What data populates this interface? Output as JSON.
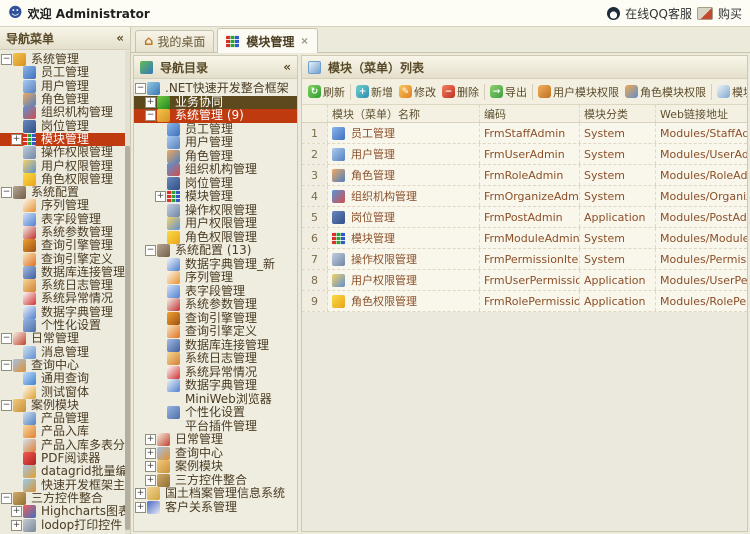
{
  "topbar": {
    "welcome": "欢迎 Administrator",
    "online_service": "在线QQ客服",
    "buy": "购买"
  },
  "tabs": [
    {
      "label": "我的桌面",
      "icon": "home",
      "active": false,
      "closable": false
    },
    {
      "label": "模块管理",
      "icon": "module",
      "active": true,
      "closable": true,
      "close_glyph": "×"
    }
  ],
  "left_panel": {
    "title": "导航菜单",
    "collapse_glyph": "«",
    "items": [
      {
        "l": "系统管理",
        "i": "sysfolder",
        "v": 0,
        "e": "-",
        "s": ""
      },
      {
        "l": "员工管理",
        "i": "staff",
        "v": 1,
        "e": "",
        "s": ""
      },
      {
        "l": "用户管理",
        "i": "user",
        "v": 1,
        "e": "",
        "s": ""
      },
      {
        "l": "角色管理",
        "i": "role",
        "v": 1,
        "e": "",
        "s": ""
      },
      {
        "l": "组织机构管理",
        "i": "org",
        "v": 1,
        "e": "",
        "s": ""
      },
      {
        "l": "岗位管理",
        "i": "post",
        "v": 1,
        "e": "",
        "s": ""
      },
      {
        "l": "模块管理",
        "i": "module",
        "v": 1,
        "e": "+",
        "s": "selo"
      },
      {
        "l": "操作权限管理",
        "i": "perm",
        "v": 1,
        "e": "",
        "s": ""
      },
      {
        "l": "用户权限管理",
        "i": "userperm",
        "v": 1,
        "e": "",
        "s": ""
      },
      {
        "l": "角色权限管理",
        "i": "roleperm",
        "v": 1,
        "e": "",
        "s": ""
      },
      {
        "l": "系统配置",
        "i": "config",
        "v": 0,
        "e": "-",
        "s": ""
      },
      {
        "l": "序列管理",
        "i": "seq",
        "v": 1,
        "e": "",
        "s": ""
      },
      {
        "l": "表字段管理",
        "i": "field",
        "v": 1,
        "e": "",
        "s": ""
      },
      {
        "l": "系统参数管理",
        "i": "param",
        "v": 1,
        "e": "",
        "s": ""
      },
      {
        "l": "查询引擎管理",
        "i": "engine",
        "v": 1,
        "e": "",
        "s": ""
      },
      {
        "l": "查询引擎定义",
        "i": "enginedef",
        "v": 1,
        "e": "",
        "s": ""
      },
      {
        "l": "数据库连接管理",
        "i": "db",
        "v": 1,
        "e": "",
        "s": ""
      },
      {
        "l": "系统日志管理",
        "i": "log",
        "v": 1,
        "e": "",
        "s": ""
      },
      {
        "l": "系统异常情况",
        "i": "error",
        "v": 1,
        "e": "",
        "s": ""
      },
      {
        "l": "数据字典管理",
        "i": "dict",
        "v": 1,
        "e": "",
        "s": ""
      },
      {
        "l": "个性化设置",
        "i": "personal",
        "v": 1,
        "e": "",
        "s": ""
      },
      {
        "l": "日常管理",
        "i": "daily",
        "v": 0,
        "e": "-",
        "s": ""
      },
      {
        "l": "消息管理",
        "i": "msg",
        "v": 1,
        "e": "",
        "s": ""
      },
      {
        "l": "查询中心",
        "i": "qcenter",
        "v": 0,
        "e": "-",
        "s": ""
      },
      {
        "l": "通用查询",
        "i": "query",
        "v": 1,
        "e": "",
        "s": ""
      },
      {
        "l": "测试窗体",
        "i": "testform",
        "v": 1,
        "e": "",
        "s": ""
      },
      {
        "l": "案例模块",
        "i": "casebox",
        "v": 0,
        "e": "-",
        "s": ""
      },
      {
        "l": "产品管理",
        "i": "product",
        "v": 1,
        "e": "",
        "s": ""
      },
      {
        "l": "产品入库",
        "i": "productin",
        "v": 1,
        "e": "",
        "s": ""
      },
      {
        "l": "产品入库多表分页",
        "i": "productpage",
        "v": 1,
        "e": "",
        "s": ""
      },
      {
        "l": "PDF阅读器",
        "i": "pdf",
        "v": 1,
        "e": "",
        "s": ""
      },
      {
        "l": "datagrid批量编辑",
        "i": "datagrid",
        "v": 1,
        "e": "",
        "s": ""
      },
      {
        "l": "快速开发框架主页",
        "i": "homepage",
        "v": 1,
        "e": "",
        "s": ""
      },
      {
        "l": "三方控件整合",
        "i": "thirdparty",
        "v": 0,
        "e": "-",
        "s": ""
      },
      {
        "l": "Highcharts图表",
        "i": "highcharts",
        "v": 1,
        "e": "+",
        "s": ""
      },
      {
        "l": "lodop打印控件",
        "i": "lodop",
        "v": 1,
        "e": "+",
        "s": ""
      }
    ]
  },
  "nav_panel": {
    "title": "导航目录",
    "collapse_glyph": "«",
    "items": [
      {
        "l": ".NET快速开发整合框架",
        "i": "netroot",
        "v": 0,
        "e": "-",
        "s": ""
      },
      {
        "l": "业务协同",
        "i": "biz",
        "v": 1,
        "e": "+",
        "s": "seld"
      },
      {
        "l": "系统管理 (9)",
        "i": "sysfolder",
        "v": 1,
        "e": "-",
        "s": "selo"
      },
      {
        "l": "员工管理",
        "i": "staff",
        "v": 2,
        "e": "",
        "s": ""
      },
      {
        "l": "用户管理",
        "i": "user",
        "v": 2,
        "e": "",
        "s": ""
      },
      {
        "l": "角色管理",
        "i": "role",
        "v": 2,
        "e": "",
        "s": ""
      },
      {
        "l": "组织机构管理",
        "i": "org",
        "v": 2,
        "e": "",
        "s": ""
      },
      {
        "l": "岗位管理",
        "i": "post",
        "v": 2,
        "e": "",
        "s": ""
      },
      {
        "l": "模块管理",
        "i": "module",
        "v": 2,
        "e": "+",
        "s": ""
      },
      {
        "l": "操作权限管理",
        "i": "perm",
        "v": 2,
        "e": "",
        "s": ""
      },
      {
        "l": "用户权限管理",
        "i": "userperm",
        "v": 2,
        "e": "",
        "s": ""
      },
      {
        "l": "角色权限管理",
        "i": "roleperm",
        "v": 2,
        "e": "",
        "s": ""
      },
      {
        "l": "系统配置 (13)",
        "i": "config",
        "v": 1,
        "e": "-",
        "s": ""
      },
      {
        "l": "数据字典管理_新",
        "i": "dict",
        "v": 2,
        "e": "",
        "s": ""
      },
      {
        "l": "序列管理",
        "i": "seq",
        "v": 2,
        "e": "",
        "s": ""
      },
      {
        "l": "表字段管理",
        "i": "field",
        "v": 2,
        "e": "",
        "s": ""
      },
      {
        "l": "系统参数管理",
        "i": "param",
        "v": 2,
        "e": "",
        "s": ""
      },
      {
        "l": "查询引擎管理",
        "i": "engine",
        "v": 2,
        "e": "",
        "s": ""
      },
      {
        "l": "查询引擎定义",
        "i": "enginedef",
        "v": 2,
        "e": "",
        "s": ""
      },
      {
        "l": "数据库连接管理",
        "i": "db",
        "v": 2,
        "e": "",
        "s": ""
      },
      {
        "l": "系统日志管理",
        "i": "log",
        "v": 2,
        "e": "",
        "s": ""
      },
      {
        "l": "系统异常情况",
        "i": "error",
        "v": 2,
        "e": "",
        "s": ""
      },
      {
        "l": "数据字典管理",
        "i": "dict",
        "v": 2,
        "e": "",
        "s": ""
      },
      {
        "l": "MiniWeb浏览器",
        "i": "miniweb",
        "v": 2,
        "e": "",
        "s": ""
      },
      {
        "l": "个性化设置",
        "i": "personal",
        "v": 2,
        "e": "",
        "s": ""
      },
      {
        "l": "平台插件管理",
        "i": "plugin",
        "v": 2,
        "e": "",
        "s": ""
      },
      {
        "l": "日常管理",
        "i": "daily",
        "v": 1,
        "e": "+",
        "s": ""
      },
      {
        "l": "查询中心",
        "i": "qcenter",
        "v": 1,
        "e": "+",
        "s": ""
      },
      {
        "l": "案例模块",
        "i": "casebox",
        "v": 1,
        "e": "+",
        "s": ""
      },
      {
        "l": "三方控件整合",
        "i": "thirdparty",
        "v": 1,
        "e": "+",
        "s": ""
      },
      {
        "l": "国土档案管理信息系统",
        "i": "landfolder",
        "v": 0,
        "e": "+",
        "s": ""
      },
      {
        "l": "客户关系管理",
        "i": "crm",
        "v": 0,
        "e": "+",
        "s": ""
      }
    ]
  },
  "list_panel": {
    "title": "模块（菜单）列表",
    "toolbar": [
      {
        "type": "button",
        "label": "刷新",
        "icon": "refresh"
      },
      {
        "type": "separator"
      },
      {
        "type": "button",
        "label": "新增",
        "icon": "add"
      },
      {
        "type": "button",
        "label": "修改",
        "icon": "edit"
      },
      {
        "type": "button",
        "label": "删除",
        "icon": "delete"
      },
      {
        "type": "separator"
      },
      {
        "type": "button",
        "label": "导出",
        "icon": "export"
      },
      {
        "type": "separator"
      },
      {
        "type": "button",
        "label": "用户模块权限",
        "icon": "usermodperm"
      },
      {
        "type": "button",
        "label": "角色模块权限",
        "icon": "rolemodperm"
      },
      {
        "type": "separator"
      },
      {
        "type": "button",
        "label": "模块配置",
        "icon": "modconfig"
      }
    ],
    "grid": {
      "columns": [
        "",
        "模块（菜单）名称",
        "编码",
        "模块分类",
        "Web链接地址"
      ],
      "rows": [
        {
          "num": "1",
          "icon": "staff",
          "name": "员工管理",
          "code": "FrmStaffAdmin",
          "category": "System",
          "web": "Modules/StaffAdmin"
        },
        {
          "num": "2",
          "icon": "user",
          "name": "用户管理",
          "code": "FrmUserAdmin",
          "category": "System",
          "web": "Modules/UserAdmin"
        },
        {
          "num": "3",
          "icon": "role",
          "name": "角色管理",
          "code": "FrmRoleAdmin",
          "category": "System",
          "web": "Modules/RoleAdmin"
        },
        {
          "num": "4",
          "icon": "org",
          "name": "组织机构管理",
          "code": "FrmOrganizeAdmin",
          "category": "System",
          "web": "Modules/OrganizeA"
        },
        {
          "num": "5",
          "icon": "post",
          "name": "岗位管理",
          "code": "FrmPostAdmin",
          "category": "Application",
          "web": "Modules/PostAdmin"
        },
        {
          "num": "6",
          "icon": "module",
          "name": "模块管理",
          "code": "FrmModuleAdmin",
          "category": "System",
          "web": "Modules/ModuleAd"
        },
        {
          "num": "7",
          "icon": "perm",
          "name": "操作权限管理",
          "code": "FrmPermissionItemA",
          "category": "System",
          "web": "Modules/Permission"
        },
        {
          "num": "8",
          "icon": "userperm",
          "name": "用户权限管理",
          "code": "FrmUserPermissionA",
          "category": "Application",
          "web": "Modules/UserPermi"
        },
        {
          "num": "9",
          "icon": "roleperm",
          "name": "角色权限管理",
          "code": "FrmRolePermissionA",
          "category": "Application",
          "web": "Modules/RolePermi"
        }
      ]
    }
  },
  "colors": {
    "selected_node_bg": "#c03a10",
    "dark_node_bg": "#5c4a1e",
    "panel_header_text": "#584a28",
    "grid_text": "#8a4f28",
    "toolbar_bg": "#f3f0e2"
  },
  "icon_colors": {
    "sysfolder": [
      "#f2c44e",
      "#d89020"
    ],
    "staff": [
      "#8ab6e8",
      "#3f6fbf"
    ],
    "user": [
      "#a9cbee",
      "#5580c0"
    ],
    "role": [
      "#f0a860",
      "#4f7fc0"
    ],
    "org": [
      "#5a94d4",
      "#cf4f4f"
    ],
    "post": [
      "#6a88bc",
      "#2f4f88"
    ],
    "module": [
      "#d83028",
      "#3158c8"
    ],
    "perm": [
      "#c3cedd",
      "#6f85a8"
    ],
    "userperm": [
      "#f2d367",
      "#5f8fd0"
    ],
    "roleperm": [
      "#fbda45",
      "#e8a41c"
    ],
    "config": [
      "#b6a695",
      "#74604a"
    ],
    "seq": [
      "#fbf8ee",
      "#e89030"
    ],
    "field": [
      "#d3e2f7",
      "#4f7fd0"
    ],
    "param": [
      "#f3f2ea",
      "#c23030"
    ],
    "engine": [
      "#f2a132",
      "#9e5010"
    ],
    "enginedef": [
      "#f8e8c0",
      "#e07020"
    ],
    "db": [
      "#a4bce2",
      "#3f5fa0"
    ],
    "log": [
      "#f8d898",
      "#d08030"
    ],
    "error": [
      "#fbfbf8",
      "#d03030"
    ],
    "dict": [
      "#f0f4f8",
      "#4f7fd0"
    ],
    "personal": [
      "#94b8e2",
      "#4f6fa8"
    ],
    "daily": [
      "#f8f0e0",
      "#c04030"
    ],
    "msg": [
      "#d2e2f2",
      "#5f8fd0"
    ],
    "qcenter": [
      "#a2c2e8",
      "#e09030"
    ],
    "query": [
      "#c2e1f8",
      "#3f7fd0"
    ],
    "testform": [
      "#fbfaf0",
      "#e0a030"
    ],
    "casebox": [
      "#f2cb7c",
      "#c8903a"
    ],
    "product": [
      "#d2e2f2",
      "#4f7fc0"
    ],
    "productin": [
      "#f8d8a0",
      "#e08030"
    ],
    "productpage": [
      "#d2e2f2",
      "#e08030"
    ],
    "pdf": [
      "#f25c50",
      "#af2020"
    ],
    "datagrid": [
      "#a2c2e8",
      "#e0a030"
    ],
    "homepage": [
      "#8fd0f0",
      "#e09030"
    ],
    "thirdparty": [
      "#d2aa6a",
      "#8f7030"
    ],
    "highcharts": [
      "#ef6060",
      "#4070c0"
    ],
    "lodop": [
      "#c5ccd4",
      "#788898"
    ],
    "netroot": [
      "#93c9e8",
      "#3878b0"
    ],
    "biz": [
      "#74ca42",
      "#1f8a1f"
    ],
    "landfolder": [
      "#f2d393",
      "#d0a440"
    ],
    "crm": [
      "#4a66c4",
      "#e8ecf4"
    ],
    "sitemap": [
      "#66bb55",
      "#3377bb"
    ],
    "window": [
      "#e8f1f8",
      "#6f9fd0"
    ],
    "refresh": [
      "#7fd060",
      "#2f9f30"
    ],
    "add": [
      "#6fcfcf",
      "#2f8faf"
    ],
    "edit": [
      "#f8c860",
      "#e07f20"
    ],
    "delete": [
      "#f08060",
      "#c03020"
    ],
    "export": [
      "#8fd070",
      "#3f9f40"
    ],
    "usermodperm": [
      "#f0b060",
      "#c07020"
    ],
    "rolemodperm": [
      "#f0a850",
      "#5f8fd0"
    ],
    "modconfig": [
      "#eef3f8",
      "#7fa8d0"
    ]
  },
  "icon_glyphs": {
    "refresh": "↻",
    "add": "+",
    "edit": "✎",
    "delete": "−",
    "export": "→",
    "usermodperm": "",
    "rolemodperm": "",
    "modconfig": ""
  }
}
